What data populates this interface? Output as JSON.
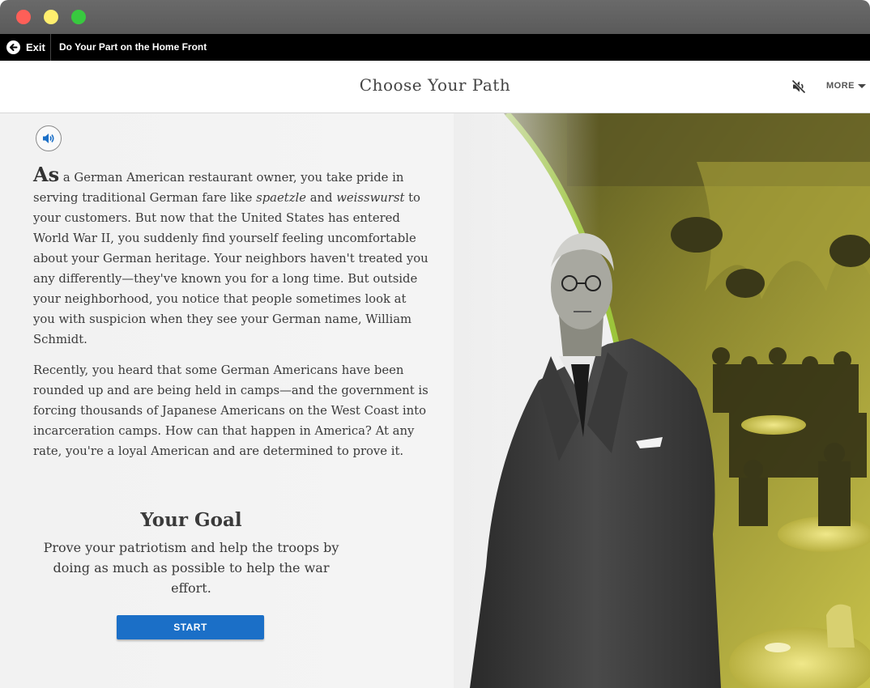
{
  "window": {
    "traffic_lights": [
      "close",
      "minimize",
      "maximize"
    ]
  },
  "nav": {
    "exit_label": "Exit",
    "title": "Do Your Part on the Home Front"
  },
  "header": {
    "title": "Choose Your Path",
    "more_label": "MORE"
  },
  "story": {
    "dropcap": "As",
    "p1_a": " a German American restaurant owner, you take pride in serving traditional German fare like ",
    "p1_em1": "spaetzle",
    "p1_and": " and ",
    "p1_em2": "weisswurst",
    "p1_b": " to your customers. But now that the United States has entered World War II, you suddenly find yourself feeling uncomfortable about your German heritage. Your neighbors haven't treated you any differently—they've known you for a long time. But outside your neighborhood, you notice that people sometimes look at you with suspicion when they see your German name, William Schmidt.",
    "p2": "Recently, you heard that some German Americans have been rounded up and are being held in camps—and the government is forcing thousands of Japanese Americans on the West Coast into incarceration camps. How can that happen in America? At any rate, you're a loyal American and are determined to prove it."
  },
  "goal": {
    "title": "Your Goal",
    "text": "Prove your patriotism and help the troops by doing as much as possible to help the war effort.",
    "start_label": "START"
  },
  "icons": {
    "exit": "arrow-left-circle-icon",
    "mute": "speaker-muted-icon",
    "audio": "speaker-icon",
    "more": "caret-down-icon"
  },
  "colors": {
    "accent_green": "#9cc53b",
    "photo_tint": "#c8c24a",
    "button_blue": "#1b6fc7"
  }
}
